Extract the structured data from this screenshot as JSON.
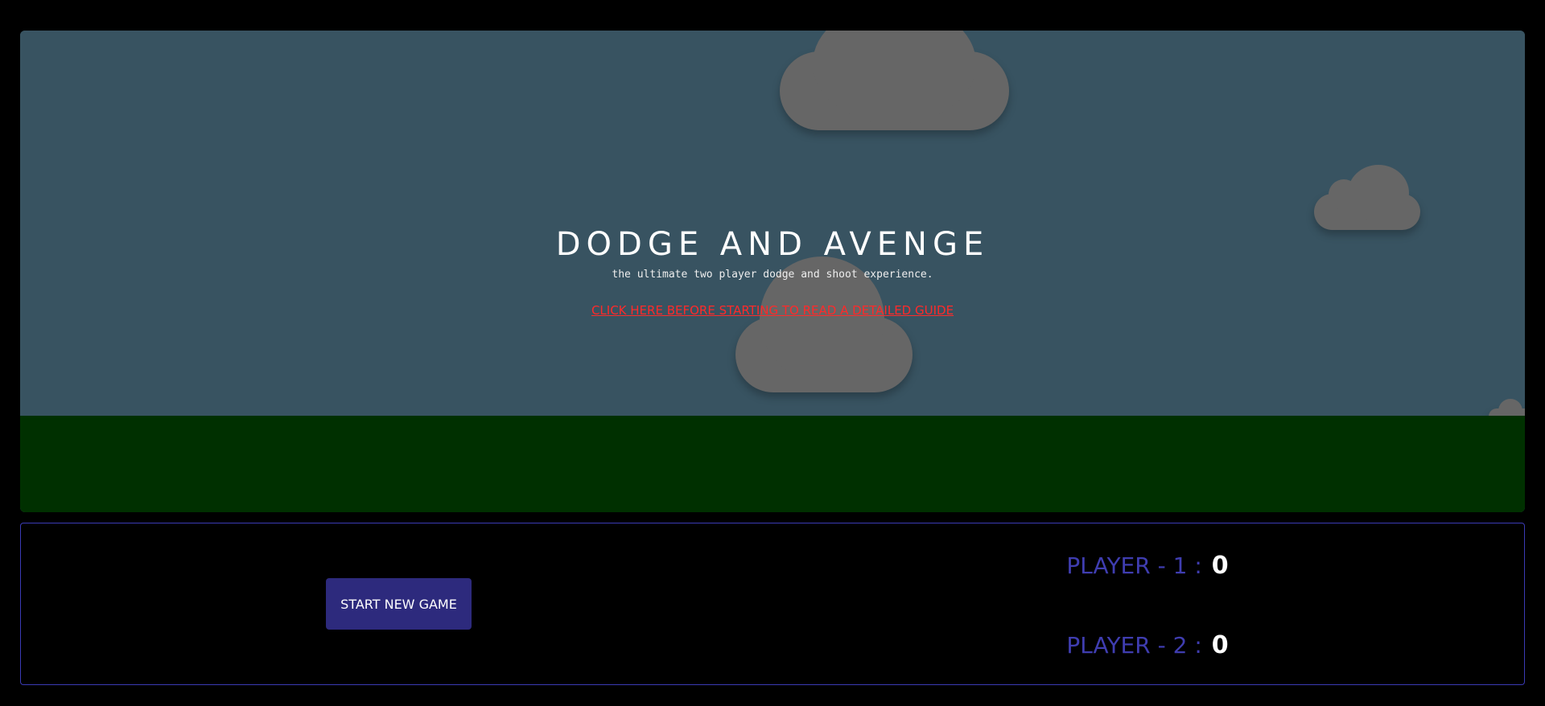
{
  "game": {
    "title": "DODGE AND AVENGE",
    "subtitle": "the ultimate two player dodge and shoot experience.",
    "guide_link": "CLICK HERE BEFORE STARTING TO READ A DETAILED GUIDE",
    "colors": {
      "sky": "#385361",
      "ground": "#003000",
      "cloud": "#666666",
      "guide_link": "#ff2a2a"
    }
  },
  "controls": {
    "start_button": "START NEW GAME",
    "start_button_color": "#2d2a7d",
    "panel_border_color": "#3b3bb5"
  },
  "scores": [
    {
      "label": "PLAYER - 1 :",
      "value": "0"
    },
    {
      "label": "PLAYER - 2 :",
      "value": "0"
    }
  ]
}
